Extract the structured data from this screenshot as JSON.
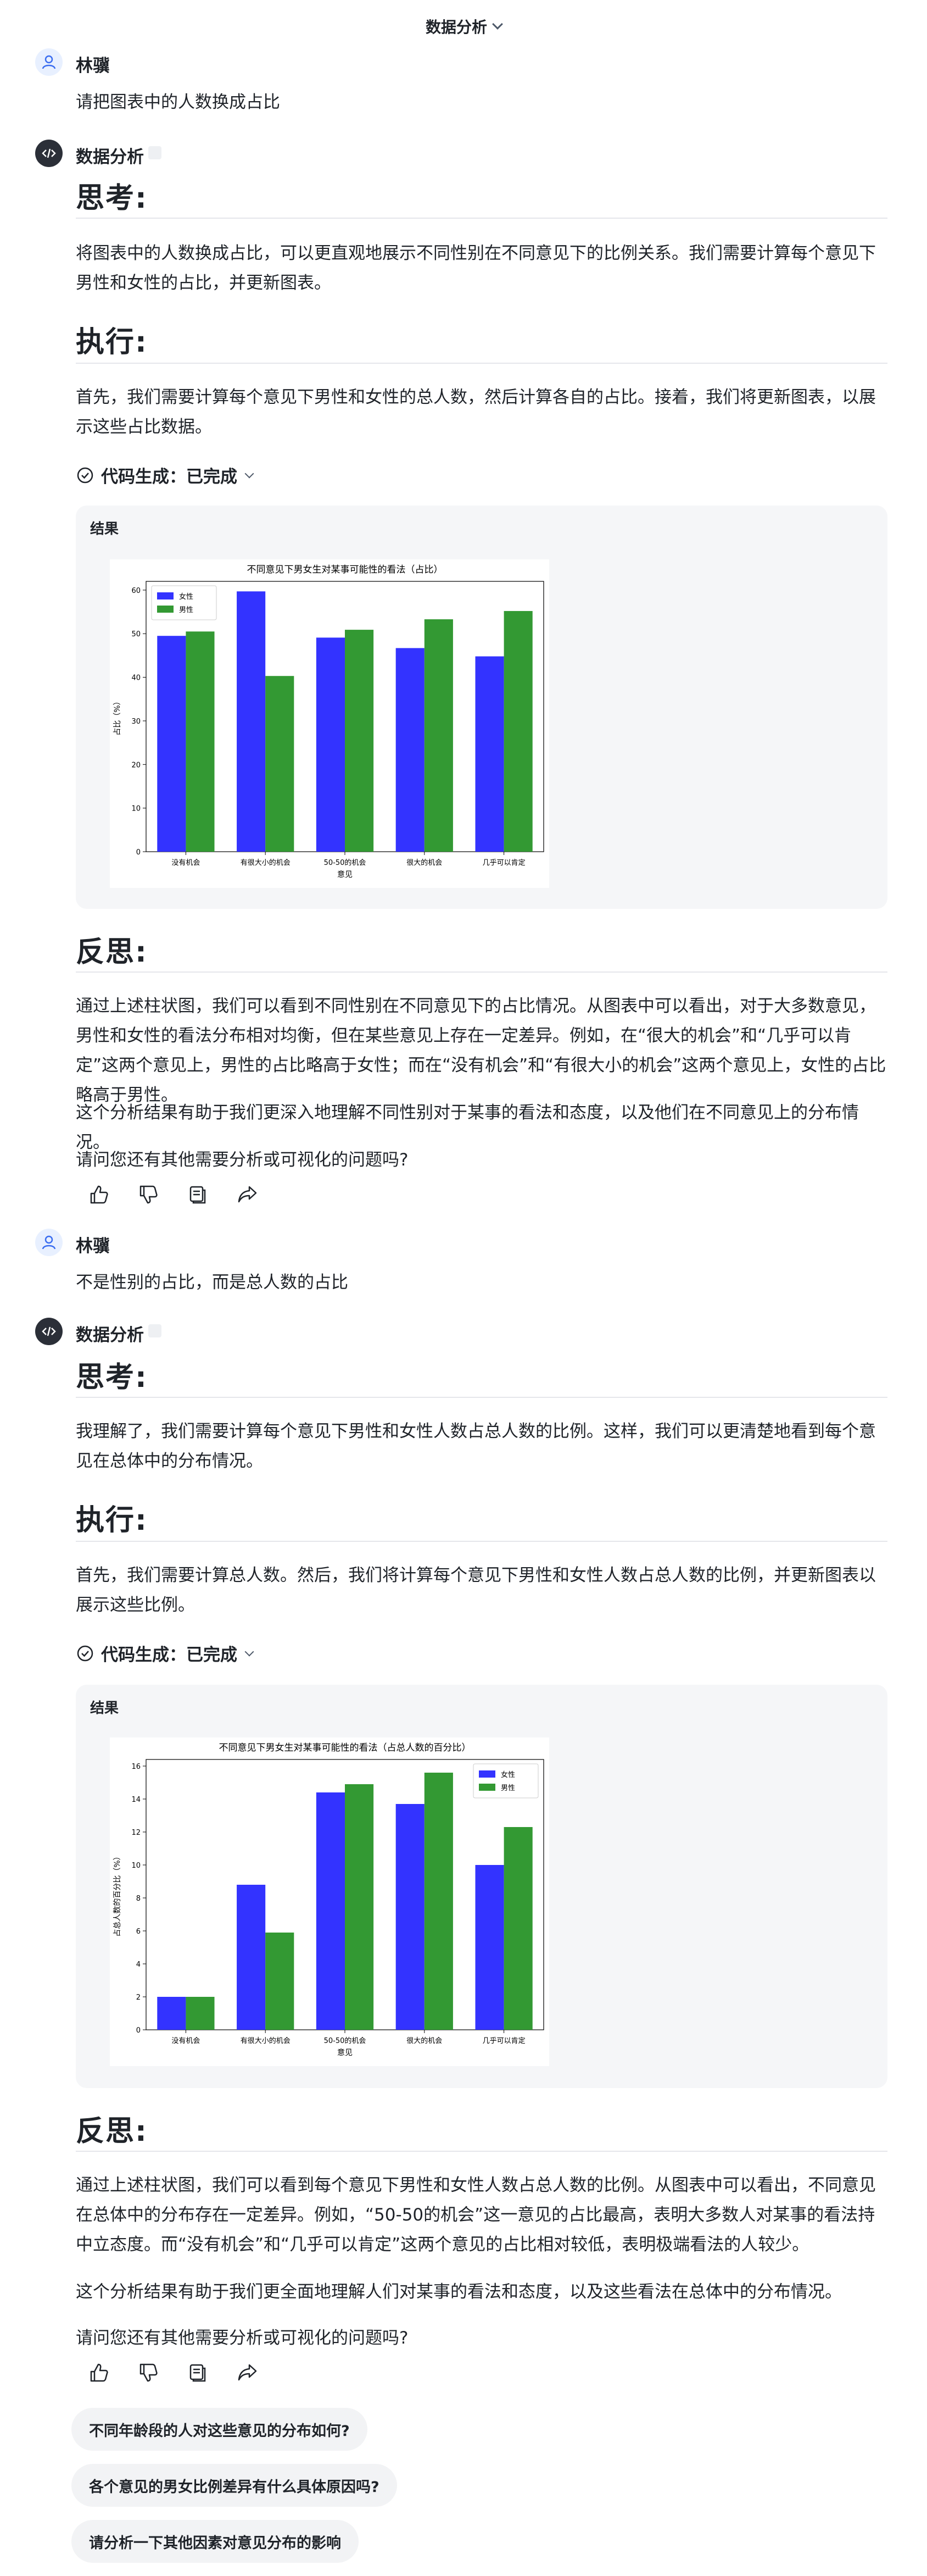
{
  "header": {
    "title": "数据分析"
  },
  "conversation": {
    "user1": {
      "name": "林骥",
      "text": "请把图表中的人数换成占比"
    },
    "bot1": {
      "name": "数据分析",
      "think_title": "思考:",
      "think_text": "将图表中的人数换成占比，可以更直观地展示不同性别在不同意见下的比例关系。我们需要计算每个意见下男性和女性的占比，并更新图表。",
      "exec_title": "执行:",
      "exec_text": "首先，我们需要计算每个意见下男性和女性的总人数，然后计算各自的占比。接着，我们将更新图表，以展示这些占比数据。",
      "codegen_label": "代码生成：已完成",
      "result_label": "结果",
      "reflect_title": "反思:",
      "reflect_p1": "通过上述柱状图，我们可以看到不同性别在不同意见下的占比情况。从图表中可以看出，对于大多数意见，男性和女性的看法分布相对均衡，但在某些意见上存在一定差异。例如，在“很大的机会”和“几乎可以肯定”这两个意见上，男性的占比略高于女性；而在“没有机会”和“有很大小的机会”这两个意见上，女性的占比略高于男性。",
      "reflect_p2": "这个分析结果有助于我们更深入地理解不同性别对于某事的看法和态度，以及他们在不同意见上的分布情况。",
      "question": "请问您还有其他需要分析或可视化的问题吗?"
    },
    "user2": {
      "name": "林骥",
      "text": "不是性别的占比，而是总人数的占比"
    },
    "bot2": {
      "name": "数据分析",
      "think_title": "思考:",
      "think_text": "我理解了，我们需要计算每个意见下男性和女性人数占总人数的比例。这样，我们可以更清楚地看到每个意见在总体中的分布情况。",
      "exec_title": "执行:",
      "exec_text": "首先，我们需要计算总人数。然后，我们将计算每个意见下男性和女性人数占总人数的比例，并更新图表以展示这些比例。",
      "codegen_label": "代码生成：已完成",
      "result_label": "结果",
      "reflect_title": "反思:",
      "reflect_p1": "通过上述柱状图，我们可以看到每个意见下男性和女性人数占总人数的比例。从图表中可以看出，不同意见在总体中的分布存在一定差异。例如，“50-50的机会”这一意见的占比最高，表明大多数人对某事的看法持中立态度。而“没有机会”和“几乎可以肯定”这两个意见的占比相对较低，表明极端看法的人较少。",
      "reflect_p2": "这个分析结果有助于我们更全面地理解人们对某事的看法和态度，以及这些看法在总体中的分布情况。",
      "question": "请问您还有其他需要分析或可视化的问题吗?"
    }
  },
  "suggestions": [
    "不同年龄段的人对这些意见的分布如何?",
    "各个意见的男女比例差异有什么具体原因吗?",
    "请分析一下其他因素对意见分布的影响"
  ],
  "chart_data": [
    {
      "type": "bar",
      "title": "不同意见下男女生对某事可能性的看法（占比）",
      "xlabel": "意见",
      "ylabel": "占比（%）",
      "categories": [
        "没有机会",
        "有很大小的机会",
        "50-50的机会",
        "很大的机会",
        "几乎可以肯定"
      ],
      "series": [
        {
          "name": "女性",
          "color": "#3333ff",
          "values": [
            49.5,
            59.7,
            49.1,
            46.7,
            44.8
          ]
        },
        {
          "name": "男性",
          "color": "#339933",
          "values": [
            50.5,
            40.3,
            50.9,
            53.3,
            55.2
          ]
        }
      ],
      "ylim": [
        0,
        62
      ],
      "yticks": [
        0,
        10,
        20,
        30,
        40,
        50,
        60
      ],
      "legend": "top-left",
      "grid": false
    },
    {
      "type": "bar",
      "title": "不同意见下男女生对某事可能性的看法（占总人数的百分比）",
      "xlabel": "意见",
      "ylabel": "占总人数的百分比（%）",
      "categories": [
        "没有机会",
        "有很大小的机会",
        "50-50的机会",
        "很大的机会",
        "几乎可以肯定"
      ],
      "series": [
        {
          "name": "女性",
          "color": "#3333ff",
          "values": [
            2.0,
            8.8,
            14.4,
            13.7,
            10.0
          ]
        },
        {
          "name": "男性",
          "color": "#339933",
          "values": [
            2.0,
            5.9,
            14.9,
            15.6,
            12.3
          ]
        }
      ],
      "ylim": [
        0,
        16.4
      ],
      "yticks": [
        0,
        2,
        4,
        6,
        8,
        10,
        12,
        14,
        16
      ],
      "legend": "top-right",
      "grid": false
    }
  ]
}
